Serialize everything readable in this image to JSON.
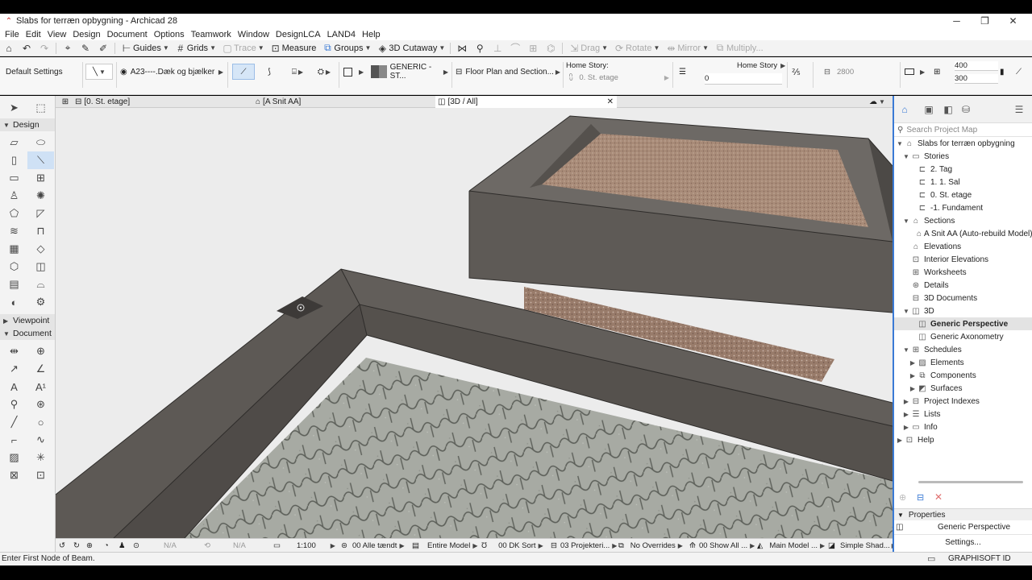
{
  "window": {
    "title": "Slabs for terræn opbygning - Archicad 28",
    "min": "─",
    "max": "❐",
    "close": "✕"
  },
  "menu": [
    "File",
    "Edit",
    "View",
    "Design",
    "Document",
    "Options",
    "Teamwork",
    "Window",
    "DesignLCA",
    "LAND4",
    "Help"
  ],
  "toolbar": {
    "guides": "Guides",
    "grids": "Grids",
    "trace": "Trace",
    "measure": "Measure",
    "groups": "Groups",
    "cutaway": "3D Cutaway",
    "drag": "Drag",
    "rotate": "Rotate",
    "mirror": "Mirror",
    "multiply": "Multiply..."
  },
  "infobox": {
    "default_settings": "Default Settings",
    "layer": "A23----.Dæk og bjælker",
    "material": "GENERIC - ST...",
    "view": "Floor Plan and Section...",
    "home_story_label": "Home Story:",
    "home_story_value": "0. St. etage",
    "home_story_right": "Home Story",
    "offset": "0",
    "height": "2800",
    "dim_top": "400",
    "dim_bottom": "300"
  },
  "tabs": {
    "floor": "[0. St. etage]",
    "section": "[A Snit AA]",
    "threed": "[3D / All]"
  },
  "toolbox": {
    "design": "Design",
    "viewpoint": "Viewpoint",
    "document": "Document"
  },
  "viewport_status": {
    "na1": "N/A",
    "na2": "N/A",
    "scale": "1:100",
    "layers": "00 Alle tændt",
    "model": "Entire Model",
    "pen": "00 DK Sort",
    "proj": "03 Projekteri...",
    "overrides": "No Overrides",
    "show": "00 Show All ...",
    "main": "Main Model ...",
    "shading": "Simple Shad..."
  },
  "navigator": {
    "search_placeholder": "Search Project Map",
    "project": "Slabs for terræn opbygning",
    "stories": "Stories",
    "story_2": "2. Tag",
    "story_1": "1. 1. Sal",
    "story_0": "0. St. etage",
    "story_m1": "-1. Fundament",
    "sections": "Sections",
    "section_a": "A Snit AA (Auto-rebuild Model)",
    "elevations": "Elevations",
    "interior_elevations": "Interior Elevations",
    "worksheets": "Worksheets",
    "details": "Details",
    "documents_3d": "3D Documents",
    "threed": "3D",
    "generic_perspective": "Generic Perspective",
    "generic_axonometry": "Generic Axonometry",
    "schedules": "Schedules",
    "elements": "Elements",
    "components": "Components",
    "surfaces": "Surfaces",
    "project_indexes": "Project Indexes",
    "lists": "Lists",
    "info": "Info",
    "help": "Help"
  },
  "properties": {
    "header": "Properties",
    "name": "Generic Perspective",
    "settings": "Settings..."
  },
  "status": {
    "prompt": "Enter First Node of Beam.",
    "brand": "GRAPHISOFT ID"
  },
  "colors": {
    "accent": "#3a7ad5",
    "concrete": "#5f5b57",
    "pavers": "#a9aca5",
    "gravel": "#9a7d6c"
  }
}
